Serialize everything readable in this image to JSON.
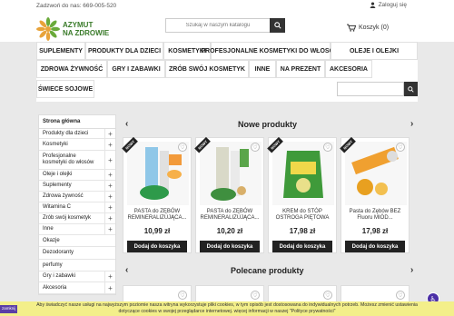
{
  "topbar": {
    "phone": "Zadzwoń do nas: 669-005-520",
    "login": "Zaloguj się"
  },
  "logo": {
    "line1": "AZYMUT",
    "line2": "NA ZDROWIE"
  },
  "search": {
    "placeholder": "Szukaj w naszym katalogu"
  },
  "cart": {
    "label": "Koszyk (0)"
  },
  "nav": {
    "items": [
      "SUPLEMENTY",
      "PRODUKTY DLA DZIECI",
      "KOSMETYKI",
      "PROFESJONALNE KOSMETYKI DO WŁOSÓW",
      "OLEJE I OLEJKI",
      "ZDROWA ŻYWNOŚĆ",
      "GRY I ZABAWKI",
      "ZRÓB SWÓJ KOSMETYK",
      "INNE",
      "NA PREZENT",
      "AKCESORIA",
      "ŚWIECE SOJOWE"
    ]
  },
  "sidebar": {
    "head": "Strona główna",
    "items": [
      {
        "label": "Produkty dla dzieci",
        "plus": "+"
      },
      {
        "label": "Kosmetyki",
        "plus": "+"
      },
      {
        "label": "Profesjonalne kosmetyki do włosów",
        "plus": "+"
      },
      {
        "label": "Oleje i olejki",
        "plus": "+"
      },
      {
        "label": "Suplementy",
        "plus": "+"
      },
      {
        "label": "Zdrowa żywność",
        "plus": "+"
      },
      {
        "label": "Witamina C",
        "plus": "+"
      },
      {
        "label": "Zrób swój kosmetyk",
        "plus": "+"
      },
      {
        "label": "Inne",
        "plus": "+"
      },
      {
        "label": "Okazje",
        "plus": ""
      },
      {
        "label": "Dezodoranty",
        "plus": ""
      },
      {
        "label": "perfumy",
        "plus": ""
      },
      {
        "label": "Gry i zabawki",
        "plus": "+"
      },
      {
        "label": "Akcesoria",
        "plus": "+"
      }
    ]
  },
  "new_products": {
    "title": "Nowe produkty",
    "badge": "NOWY",
    "add_label": "Dodaj do koszyka",
    "items": [
      {
        "name": "PASTA do ZĘBÓW REMINERALIZUJĄCA...",
        "price": "10,99 zł"
      },
      {
        "name": "PASTA do ZĘBÓW REMINERALIZUJĄCA...",
        "price": "10,20 zł"
      },
      {
        "name": "KREM do STÓP OSTROGA PIĘTOWA",
        "price": "17,98 zł"
      },
      {
        "name": "Pasta do Zębów BEZ Fluoru MIÓD...",
        "price": "17,98 zł"
      }
    ]
  },
  "recommended": {
    "title": "Polecane produkty"
  },
  "cookie": {
    "close": "zamknij",
    "line1": "Aby świadczyć nasze usługi na najwyższym poziomie nasza witryna wykorzystuje pliki cookies, w tym opisób jest dostosowana do indywidualnych potrzeb. Możesz zmienić ustawienia",
    "line2": "dotyczące cookies w swojej przeglądarce internetowej. więcej informacji w naszej \"Polityce prywatności\""
  },
  "colors": {
    "nav_border": "#e0e0e0",
    "dark": "#222222",
    "cookie_bg": "#f3ef8a",
    "logo_green": "#3a7b2a"
  }
}
